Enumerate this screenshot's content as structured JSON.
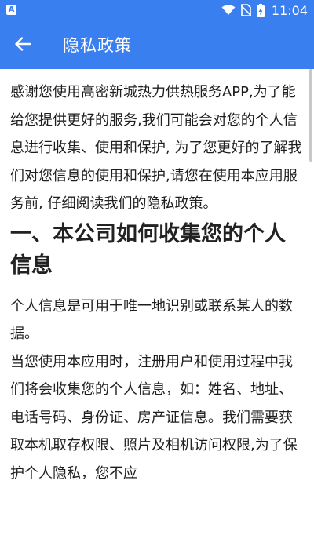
{
  "status_bar": {
    "time": "11:04",
    "left_icon_letter": "A",
    "icons": [
      "app-notification-icon",
      "wifi-icon",
      "no-sim-icon",
      "battery-charging-icon"
    ]
  },
  "app_bar": {
    "title": "隐私政策",
    "back_icon": "arrow-left-icon",
    "background": "#3a7ff0"
  },
  "content": {
    "intro": "感谢您使用高密新城热力供热服务APP,为了能给您提供更好的服务,我们可能会对您的个人信息进行收集、使用和保护, 为了您更好的了解我们对您信息的使用和保护,请您在使用本应用服务前, 仔细阅读我们的隐私政策。",
    "section1_heading": "一、本公司如何收集您的个人信息",
    "definition": "个人信息是可用于唯一地识别或联系某人的数据。",
    "collection_text": "当您使用本应用时，注册用户和使用过程中我们将会收集您的个人信息，如：姓名、地址、电话号码、身份证、房产证信息。我们需要获取本机取存权限、照片及相机访问权限,为了保护个人隐私，您不应"
  }
}
